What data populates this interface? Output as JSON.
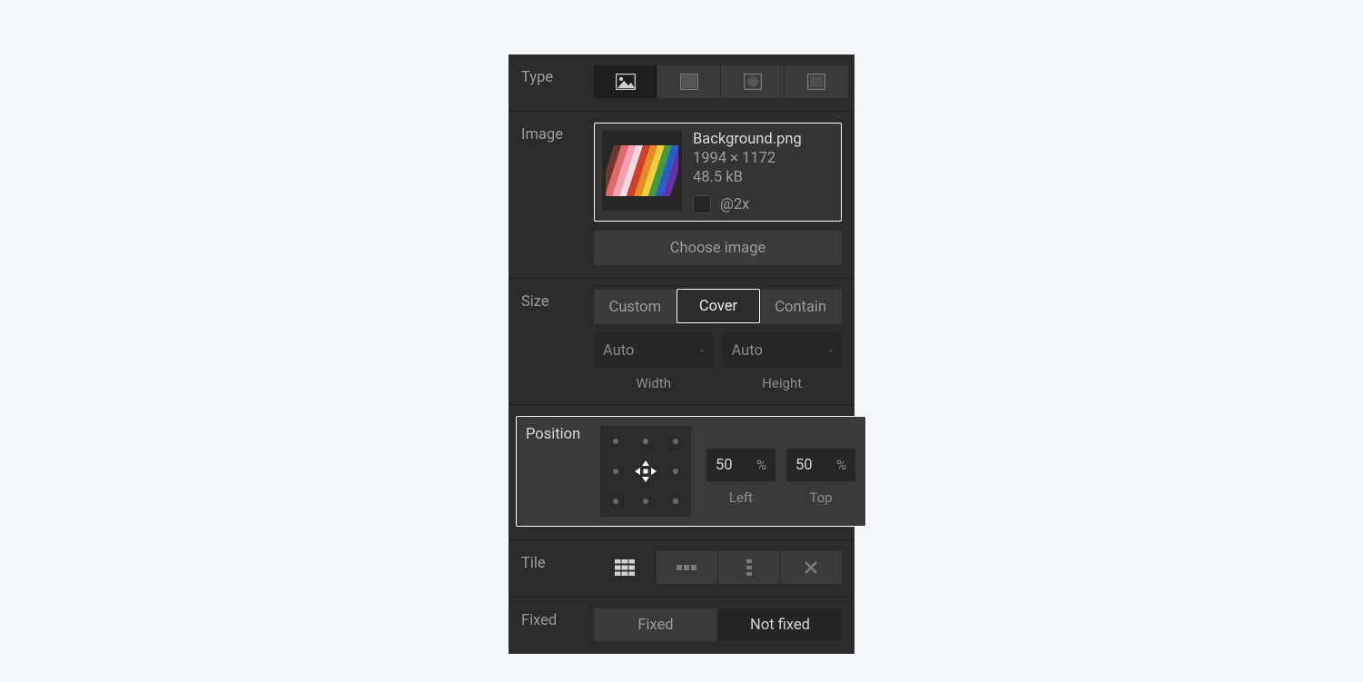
{
  "labels": {
    "type": "Type",
    "image": "Image",
    "size": "Size",
    "position": "Position",
    "tile": "Tile",
    "fixed": "Fixed"
  },
  "image": {
    "filename": "Background.png",
    "dimensions": "1994 × 1172",
    "filesize": "48.5 kB",
    "at2x_label": "@2x",
    "choose_label": "Choose image"
  },
  "size": {
    "options": {
      "custom": "Custom",
      "cover": "Cover",
      "contain": "Contain"
    },
    "width_value": "Auto",
    "width_unit": "-",
    "width_label": "Width",
    "height_value": "Auto",
    "height_unit": "-",
    "height_label": "Height"
  },
  "position": {
    "left_value": "50",
    "left_unit": "%",
    "left_label": "Left",
    "top_value": "50",
    "top_unit": "%",
    "top_label": "Top"
  },
  "fixed": {
    "fixed_label": "Fixed",
    "not_fixed_label": "Not fixed"
  }
}
